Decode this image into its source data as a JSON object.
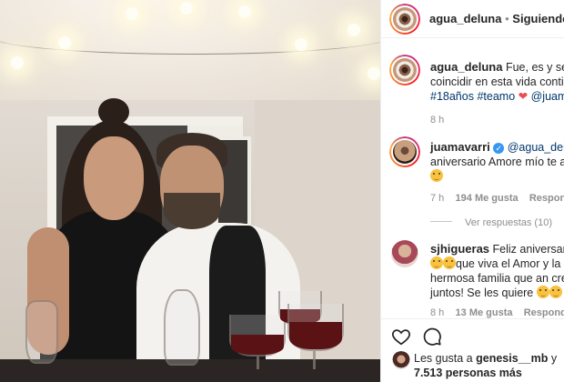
{
  "header": {
    "username": "agua_deluna",
    "separator": "•",
    "follow_status": "Siguiendo"
  },
  "caption": {
    "username": "agua_deluna",
    "text_line1": "Fue, es y será un",
    "text_line2": "coincidir en esta vida contigo",
    "hashtag1": "#18años",
    "hashtag2": "#teamo",
    "mention": "@juama",
    "time": "8 h"
  },
  "comments": [
    {
      "username": "juamavarri",
      "mention": "@agua_deluna",
      "text_line2": "aniversario Amore mío te amo",
      "time": "7 h",
      "likes": "194 Me gusta",
      "reply_label": "Responder",
      "view_replies": "Ver respuestas (10)"
    },
    {
      "username": "sjhigueras",
      "text_line1": "Feliz aniversario ch",
      "text_line2": "que viva el Amor y la",
      "text_line3": "hermosa familia que an creado",
      "text_line4": "juntos! Se les quiere",
      "time": "8 h",
      "likes": "13 Me gusta",
      "reply_label": "Responder"
    }
  ],
  "likes": {
    "prefix": "Les gusta a",
    "user": "genesis__mb",
    "conj": "y",
    "count": "7.513 personas más"
  },
  "icons": [
    "heart-icon",
    "comment-icon",
    "verified-badge-icon",
    "red-heart-icon",
    "smile-emoji-icon"
  ],
  "colors": {
    "link": "#00376b",
    "muted": "#8e8e8e",
    "verified": "#3897f0",
    "like_red": "#ed4956"
  }
}
